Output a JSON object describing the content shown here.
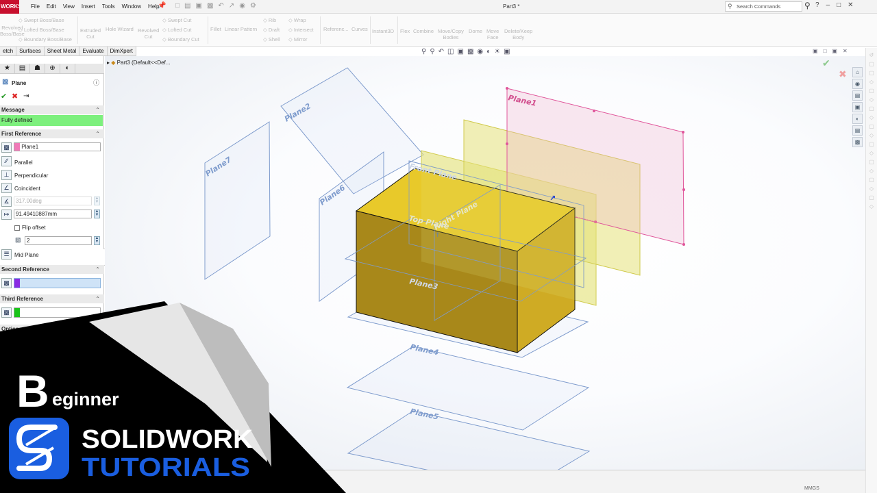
{
  "titlebar": {
    "brand": "WORKS",
    "menus": [
      "File",
      "Edit",
      "View",
      "Insert",
      "Tools",
      "Window",
      "Help"
    ],
    "doc_title": "Part3 *",
    "search_placeholder": "Search Commands"
  },
  "command_manager": {
    "group1": [
      "Revolved",
      "Boss/Base"
    ],
    "group1b": [
      "Swept Boss/Base",
      "Lofted Boss/Base",
      "Boundary Boss/Base"
    ],
    "group2": [
      "Extruded",
      "Cut"
    ],
    "hole": "Hole Wizard",
    "revolved_cut": [
      "Revolved",
      "Cut"
    ],
    "group3": [
      "Swept Cut",
      "Lofted Cut",
      "Boundary Cut"
    ],
    "fillet": "Fillet",
    "linear_pattern": "Linear Pattern",
    "group4": [
      "Rib",
      "Draft",
      "Shell"
    ],
    "group5": [
      "Wrap",
      "Intersect",
      "Mirror"
    ],
    "ref": "Referenc...",
    "curves": "Curves",
    "instant3d": "Instant3D",
    "flex": "Flex",
    "combine": "Combine",
    "movecopy": [
      "Move/Copy",
      "Bodies"
    ],
    "dome": "Dome",
    "moveface": [
      "Move",
      "Face"
    ],
    "deletekeep": [
      "Delete/Keep",
      "Body"
    ]
  },
  "tabs": [
    "etch",
    "Surfaces",
    "Sheet Metal",
    "Evaluate",
    "DimXpert"
  ],
  "tree_item": "Part3  (Default<<Def...",
  "property_manager": {
    "title": "Plane",
    "message_header": "Message",
    "message": "Fully defined",
    "first_ref": {
      "header": "First Reference",
      "value": "Plane1",
      "color": "#f07ab8",
      "options": [
        "Parallel",
        "Perpendicular",
        "Coincident"
      ],
      "angle": "317.00deg",
      "distance": "91.49410887mm",
      "flip": "Flip offset",
      "count": "2",
      "mid": "Mid Plane"
    },
    "second_ref": {
      "header": "Second Reference",
      "color": "#8a2be2"
    },
    "third_ref": {
      "header": "Third Reference",
      "color": "#19c419"
    },
    "options_header": "Options"
  },
  "planes": [
    "Plane1",
    "Plane2",
    "Plane7",
    "Plane6",
    "Plane3",
    "Plane4",
    "Plane5",
    "Front Plane",
    "Top Plane",
    "Right Plane"
  ],
  "status": {
    "units": "MMGS"
  },
  "overlay": {
    "big_letter": "B",
    "beginner": "eginner",
    "line1": "SOLIDWORK",
    "line2": "TUTORIALS"
  },
  "colors": {
    "box": "#d7b71f",
    "plane_blue": "#6f8ec4",
    "plane1": "#e0559a",
    "yellow_plane": "#e6e27a",
    "tutorial_blue": "#1a5ee0"
  }
}
